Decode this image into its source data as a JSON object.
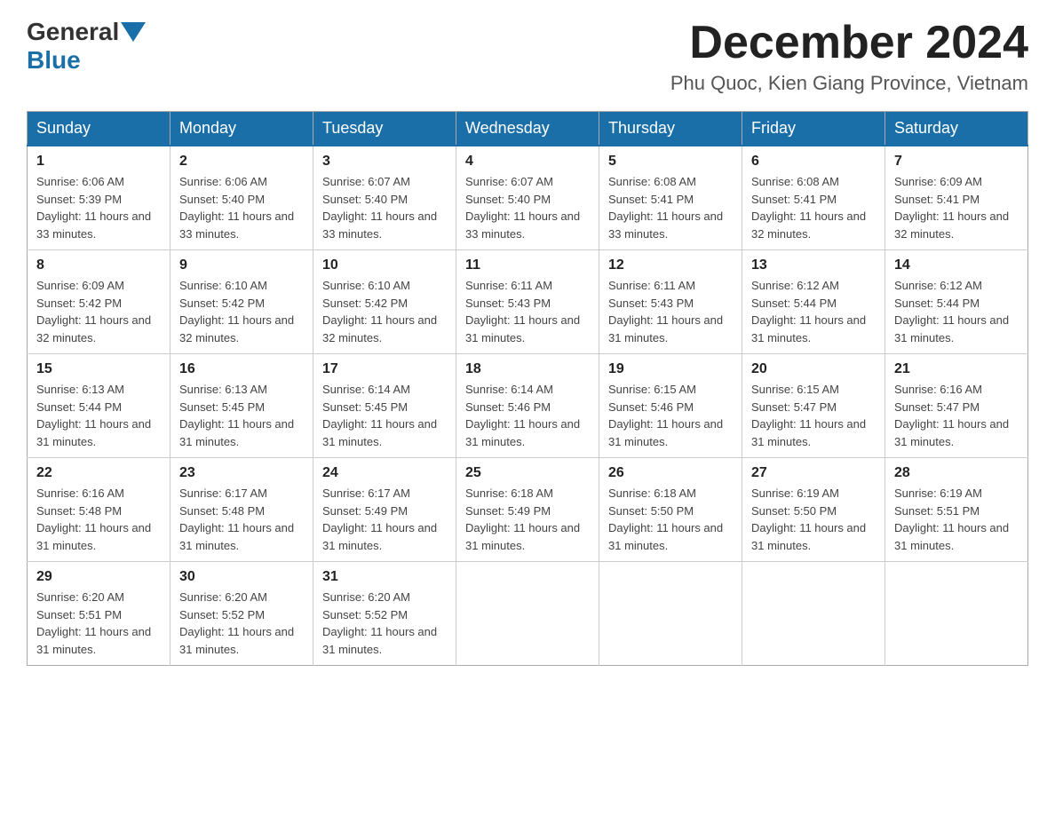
{
  "header": {
    "logo_general": "General",
    "logo_blue": "Blue",
    "month_title": "December 2024",
    "location": "Phu Quoc, Kien Giang Province, Vietnam"
  },
  "weekdays": [
    "Sunday",
    "Monday",
    "Tuesday",
    "Wednesday",
    "Thursday",
    "Friday",
    "Saturday"
  ],
  "weeks": [
    [
      {
        "day": "1",
        "sunrise": "6:06 AM",
        "sunset": "5:39 PM",
        "daylight": "11 hours and 33 minutes."
      },
      {
        "day": "2",
        "sunrise": "6:06 AM",
        "sunset": "5:40 PM",
        "daylight": "11 hours and 33 minutes."
      },
      {
        "day": "3",
        "sunrise": "6:07 AM",
        "sunset": "5:40 PM",
        "daylight": "11 hours and 33 minutes."
      },
      {
        "day": "4",
        "sunrise": "6:07 AM",
        "sunset": "5:40 PM",
        "daylight": "11 hours and 33 minutes."
      },
      {
        "day": "5",
        "sunrise": "6:08 AM",
        "sunset": "5:41 PM",
        "daylight": "11 hours and 33 minutes."
      },
      {
        "day": "6",
        "sunrise": "6:08 AM",
        "sunset": "5:41 PM",
        "daylight": "11 hours and 32 minutes."
      },
      {
        "day": "7",
        "sunrise": "6:09 AM",
        "sunset": "5:41 PM",
        "daylight": "11 hours and 32 minutes."
      }
    ],
    [
      {
        "day": "8",
        "sunrise": "6:09 AM",
        "sunset": "5:42 PM",
        "daylight": "11 hours and 32 minutes."
      },
      {
        "day": "9",
        "sunrise": "6:10 AM",
        "sunset": "5:42 PM",
        "daylight": "11 hours and 32 minutes."
      },
      {
        "day": "10",
        "sunrise": "6:10 AM",
        "sunset": "5:42 PM",
        "daylight": "11 hours and 32 minutes."
      },
      {
        "day": "11",
        "sunrise": "6:11 AM",
        "sunset": "5:43 PM",
        "daylight": "11 hours and 31 minutes."
      },
      {
        "day": "12",
        "sunrise": "6:11 AM",
        "sunset": "5:43 PM",
        "daylight": "11 hours and 31 minutes."
      },
      {
        "day": "13",
        "sunrise": "6:12 AM",
        "sunset": "5:44 PM",
        "daylight": "11 hours and 31 minutes."
      },
      {
        "day": "14",
        "sunrise": "6:12 AM",
        "sunset": "5:44 PM",
        "daylight": "11 hours and 31 minutes."
      }
    ],
    [
      {
        "day": "15",
        "sunrise": "6:13 AM",
        "sunset": "5:44 PM",
        "daylight": "11 hours and 31 minutes."
      },
      {
        "day": "16",
        "sunrise": "6:13 AM",
        "sunset": "5:45 PM",
        "daylight": "11 hours and 31 minutes."
      },
      {
        "day": "17",
        "sunrise": "6:14 AM",
        "sunset": "5:45 PM",
        "daylight": "11 hours and 31 minutes."
      },
      {
        "day": "18",
        "sunrise": "6:14 AM",
        "sunset": "5:46 PM",
        "daylight": "11 hours and 31 minutes."
      },
      {
        "day": "19",
        "sunrise": "6:15 AM",
        "sunset": "5:46 PM",
        "daylight": "11 hours and 31 minutes."
      },
      {
        "day": "20",
        "sunrise": "6:15 AM",
        "sunset": "5:47 PM",
        "daylight": "11 hours and 31 minutes."
      },
      {
        "day": "21",
        "sunrise": "6:16 AM",
        "sunset": "5:47 PM",
        "daylight": "11 hours and 31 minutes."
      }
    ],
    [
      {
        "day": "22",
        "sunrise": "6:16 AM",
        "sunset": "5:48 PM",
        "daylight": "11 hours and 31 minutes."
      },
      {
        "day": "23",
        "sunrise": "6:17 AM",
        "sunset": "5:48 PM",
        "daylight": "11 hours and 31 minutes."
      },
      {
        "day": "24",
        "sunrise": "6:17 AM",
        "sunset": "5:49 PM",
        "daylight": "11 hours and 31 minutes."
      },
      {
        "day": "25",
        "sunrise": "6:18 AM",
        "sunset": "5:49 PM",
        "daylight": "11 hours and 31 minutes."
      },
      {
        "day": "26",
        "sunrise": "6:18 AM",
        "sunset": "5:50 PM",
        "daylight": "11 hours and 31 minutes."
      },
      {
        "day": "27",
        "sunrise": "6:19 AM",
        "sunset": "5:50 PM",
        "daylight": "11 hours and 31 minutes."
      },
      {
        "day": "28",
        "sunrise": "6:19 AM",
        "sunset": "5:51 PM",
        "daylight": "11 hours and 31 minutes."
      }
    ],
    [
      {
        "day": "29",
        "sunrise": "6:20 AM",
        "sunset": "5:51 PM",
        "daylight": "11 hours and 31 minutes."
      },
      {
        "day": "30",
        "sunrise": "6:20 AM",
        "sunset": "5:52 PM",
        "daylight": "11 hours and 31 minutes."
      },
      {
        "day": "31",
        "sunrise": "6:20 AM",
        "sunset": "5:52 PM",
        "daylight": "11 hours and 31 minutes."
      },
      null,
      null,
      null,
      null
    ]
  ]
}
